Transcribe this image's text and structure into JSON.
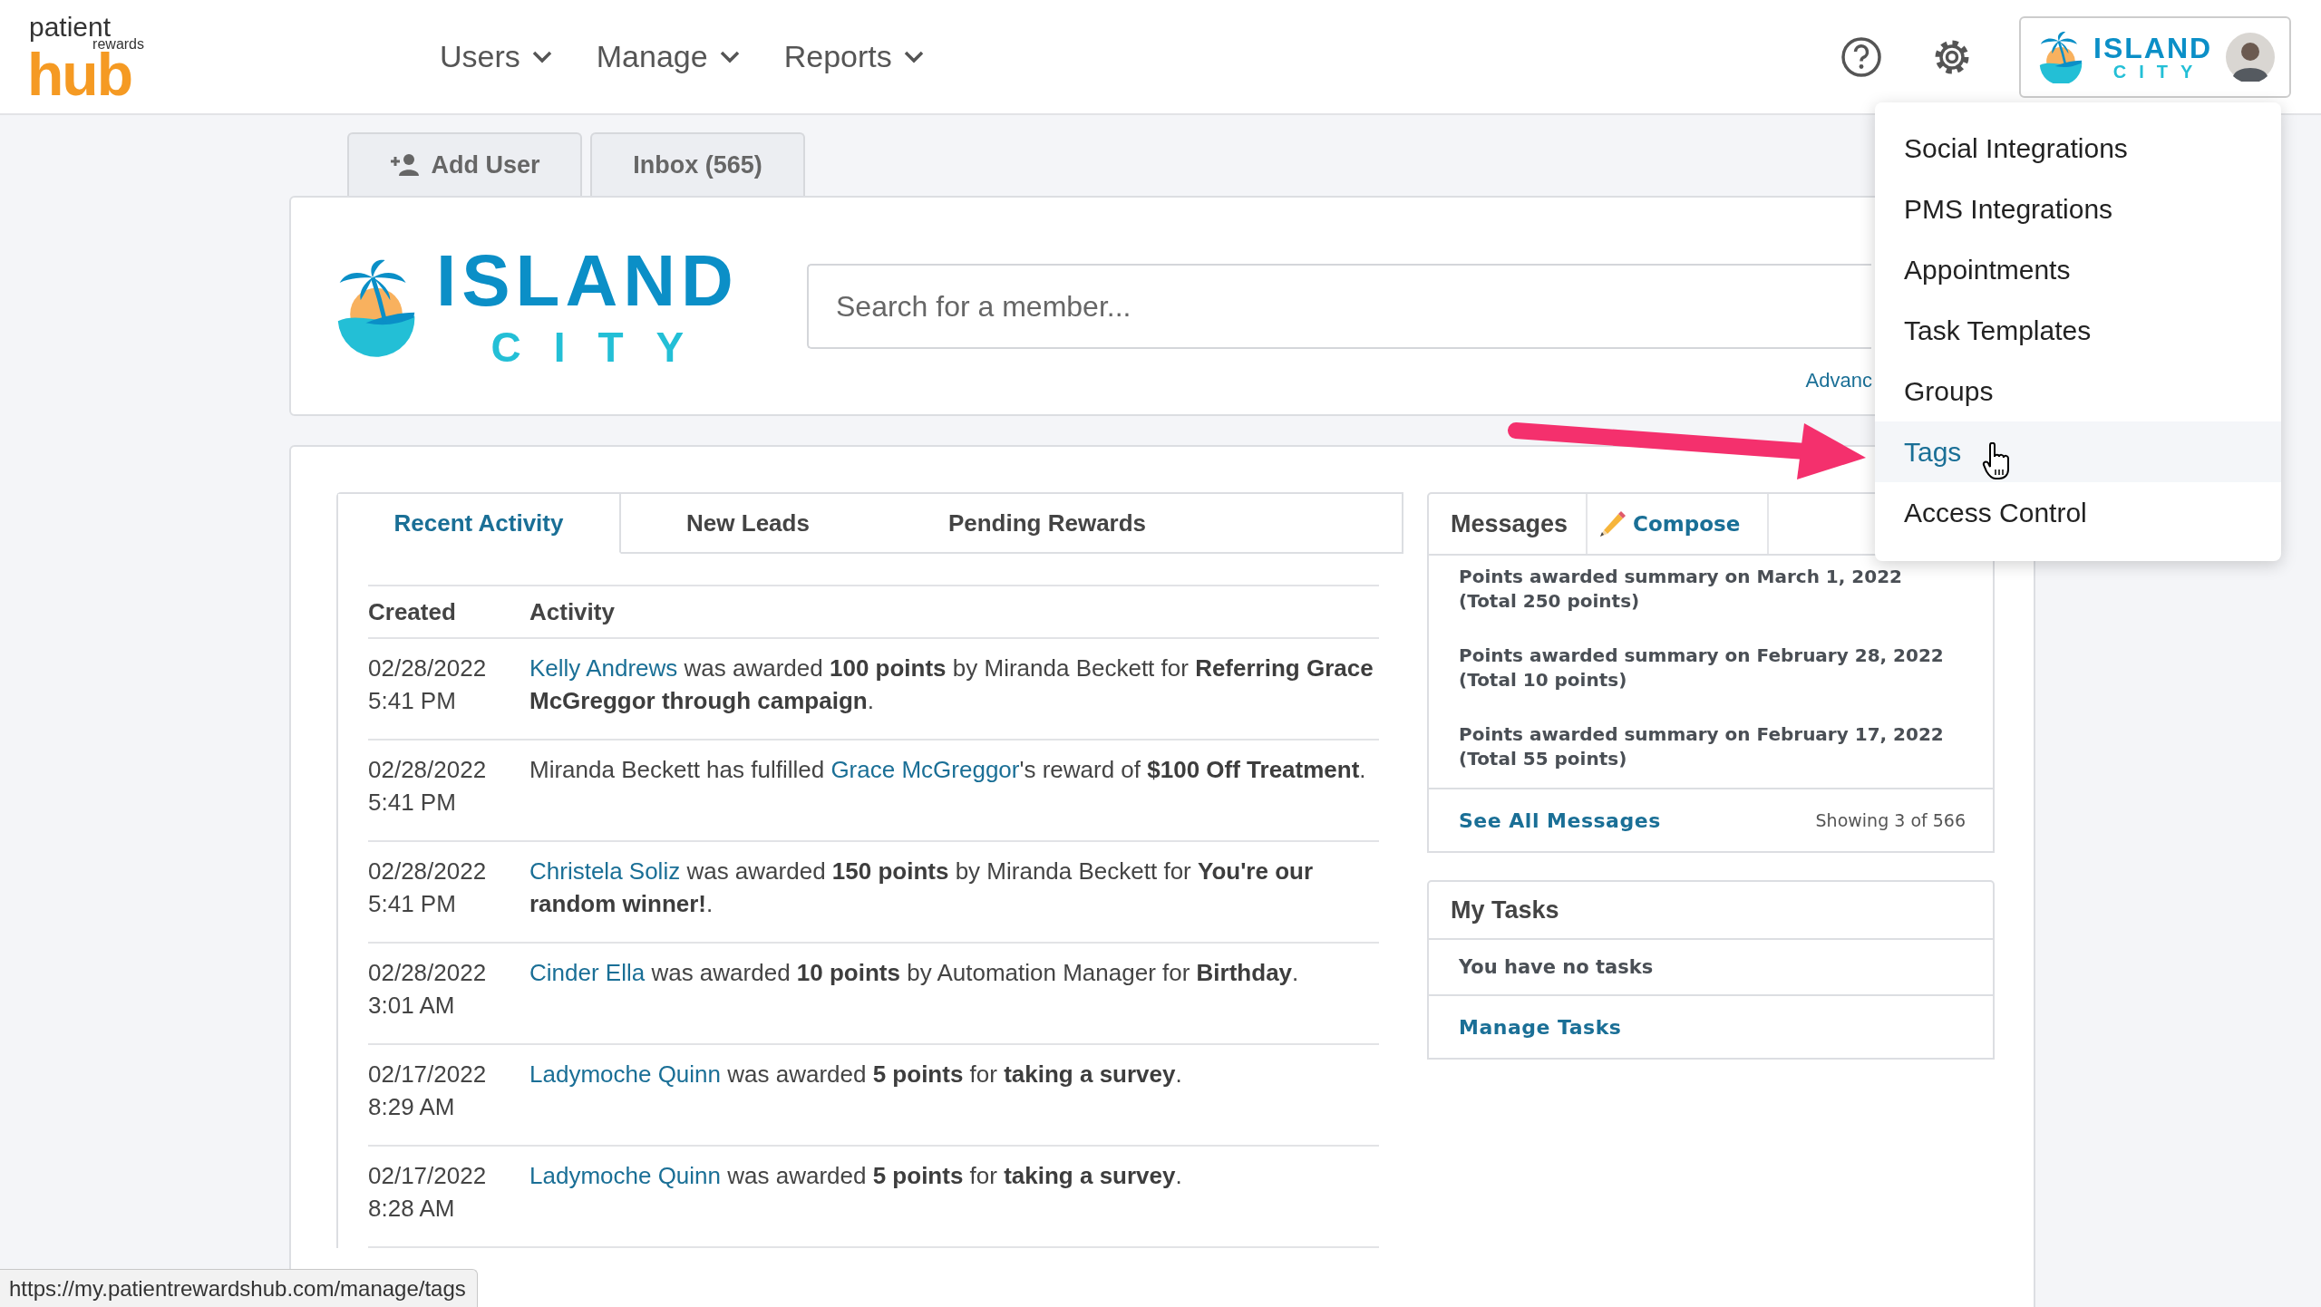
{
  "header": {
    "logo": {
      "line_1": "patient",
      "line_2": "rewards",
      "line_3": "hub"
    },
    "nav": [
      {
        "label": "Users"
      },
      {
        "label": "Manage"
      },
      {
        "label": "Reports"
      }
    ],
    "account": {
      "name_line_1": "ISLAND",
      "name_line_2": "CITY"
    }
  },
  "settings_menu": {
    "items": [
      {
        "label": "Social Integrations",
        "selected": false
      },
      {
        "label": "PMS Integrations",
        "selected": false
      },
      {
        "label": "Appointments",
        "selected": false
      },
      {
        "label": "Task Templates",
        "selected": false
      },
      {
        "label": "Groups",
        "selected": false
      },
      {
        "label": "Tags",
        "selected": true
      },
      {
        "label": "Access Control",
        "selected": false
      }
    ]
  },
  "action_tabs": [
    {
      "kind": "add-user",
      "label": "Add User"
    },
    {
      "kind": "inbox",
      "label": "Inbox (565)"
    }
  ],
  "practice": {
    "name_line_1": "ISLAND",
    "name_line_2": "CITY"
  },
  "search": {
    "placeholder": "Search for a member...",
    "advanced_link": "Advanc"
  },
  "activity": {
    "tabs": [
      {
        "label": "Recent Activity",
        "selected": true
      },
      {
        "label": "New Leads",
        "selected": false
      },
      {
        "label": "Pending Rewards",
        "selected": false
      }
    ],
    "columns": [
      "Created",
      "Activity"
    ],
    "rows": [
      {
        "created": "02/28/2022 5:41 PM",
        "segments": [
          {
            "kind": "link",
            "text": "Kelly Andrews"
          },
          {
            "kind": "text",
            "text": " was awarded **100 points** by Miranda Beckett for **Referring Grace McGreggor through campaign**."
          }
        ]
      },
      {
        "created": "02/28/2022 5:41 PM",
        "segments": [
          {
            "kind": "text",
            "text": "Miranda Beckett has fulfilled "
          },
          {
            "kind": "link",
            "text": "Grace McGreggor"
          },
          {
            "kind": "text",
            "text": "'s reward of **$100 Off Treatment**."
          }
        ]
      },
      {
        "created": "02/28/2022 5:41 PM",
        "segments": [
          {
            "kind": "link",
            "text": "Christela Soliz"
          },
          {
            "kind": "text",
            "text": " was awarded **150 points** by Miranda Beckett for **You're our random winner!**."
          }
        ]
      },
      {
        "created": "02/28/2022 3:01 AM",
        "segments": [
          {
            "kind": "link",
            "text": "Cinder Ella"
          },
          {
            "kind": "text",
            "text": " was awarded **10 points** by Automation Manager for **Birthday**."
          }
        ]
      },
      {
        "created": "02/17/2022 8:29 AM",
        "segments": [
          {
            "kind": "link",
            "text": "Ladymoche Quinn"
          },
          {
            "kind": "text",
            "text": " was awarded **5 points** for **taking a survey**."
          }
        ]
      },
      {
        "created": "02/17/2022 8:28 AM",
        "segments": [
          {
            "kind": "link",
            "text": "Ladymoche Quinn"
          },
          {
            "kind": "text",
            "text": " was awarded **5 points** for **taking a survey**."
          }
        ]
      }
    ]
  },
  "messages": {
    "title": "Messages",
    "compose": "Compose",
    "items": [
      "Points awarded summary on March 1, 2022 (Total 250 points)",
      "Points awarded summary on February 28, 2022 (Total 10 points)",
      "Points awarded summary on February 17, 2022 (Total 55 points)"
    ],
    "see_all": "See All Messages",
    "showing": "Showing 3 of 566"
  },
  "tasks": {
    "title": "My Tasks",
    "empty": "You have no tasks",
    "manage": "Manage Tasks"
  },
  "status_bar": {
    "url": "https://my.patientrewardshub.com/manage/tags"
  }
}
